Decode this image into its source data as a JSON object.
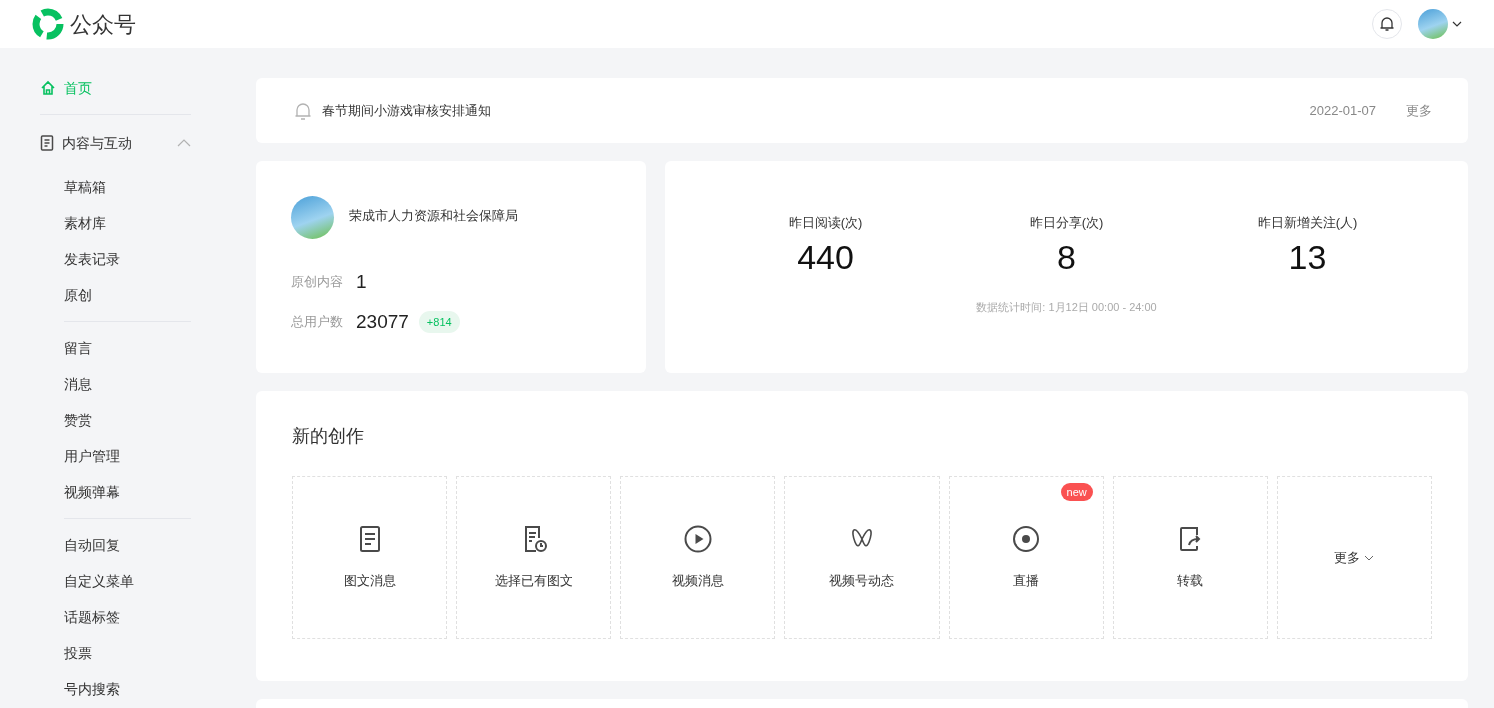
{
  "header": {
    "logo_text": "公众号"
  },
  "sidebar": {
    "items": [
      {
        "label": "首页",
        "kind": "link",
        "selected": true
      },
      {
        "label": "内容与互动",
        "kind": "section",
        "expanded": true,
        "groups": [
          [
            {
              "label": "草稿箱",
              "selected": false
            },
            {
              "label": "素材库",
              "selected": false
            },
            {
              "label": "发表记录",
              "selected": false
            },
            {
              "label": "原创",
              "selected": false
            }
          ],
          [
            {
              "label": "留言",
              "selected": false
            },
            {
              "label": "消息",
              "selected": false
            },
            {
              "label": "赞赏",
              "selected": false
            },
            {
              "label": "用户管理",
              "selected": false
            },
            {
              "label": "视频弹幕",
              "selected": false
            }
          ],
          [
            {
              "label": "自动回复",
              "selected": false
            },
            {
              "label": "自定义菜单",
              "selected": false
            },
            {
              "label": "话题标签",
              "selected": false
            },
            {
              "label": "投票",
              "selected": false
            },
            {
              "label": "号内搜索",
              "selected": false
            }
          ]
        ]
      }
    ]
  },
  "notice": {
    "title": "春节期间小游戏审核安排通知",
    "date": "2022-01-07",
    "more": "更多"
  },
  "account": {
    "name": "荣成市人力资源和社会保障局",
    "stats": [
      {
        "label": "原创内容",
        "value": "1"
      },
      {
        "label": "总用户数",
        "value": "23077",
        "badge": "+814"
      }
    ]
  },
  "metrics": {
    "items": [
      {
        "label": "昨日阅读(次)",
        "value": "440"
      },
      {
        "label": "昨日分享(次)",
        "value": "8"
      },
      {
        "label": "昨日新增关注(人)",
        "value": "13"
      }
    ],
    "footnote": "数据统计时间: 1月12日 00:00 - 24:00"
  },
  "creation": {
    "title": "新的创作",
    "tools": [
      {
        "label": "图文消息",
        "kind": "article"
      },
      {
        "label": "选择已有图文",
        "kind": "pick-article"
      },
      {
        "label": "视频消息",
        "kind": "video"
      },
      {
        "label": "视频号动态",
        "kind": "channels"
      },
      {
        "label": "直播",
        "kind": "live",
        "badge": "new"
      },
      {
        "label": "转载",
        "kind": "repost"
      },
      {
        "label": "更多",
        "kind": "more"
      }
    ]
  }
}
